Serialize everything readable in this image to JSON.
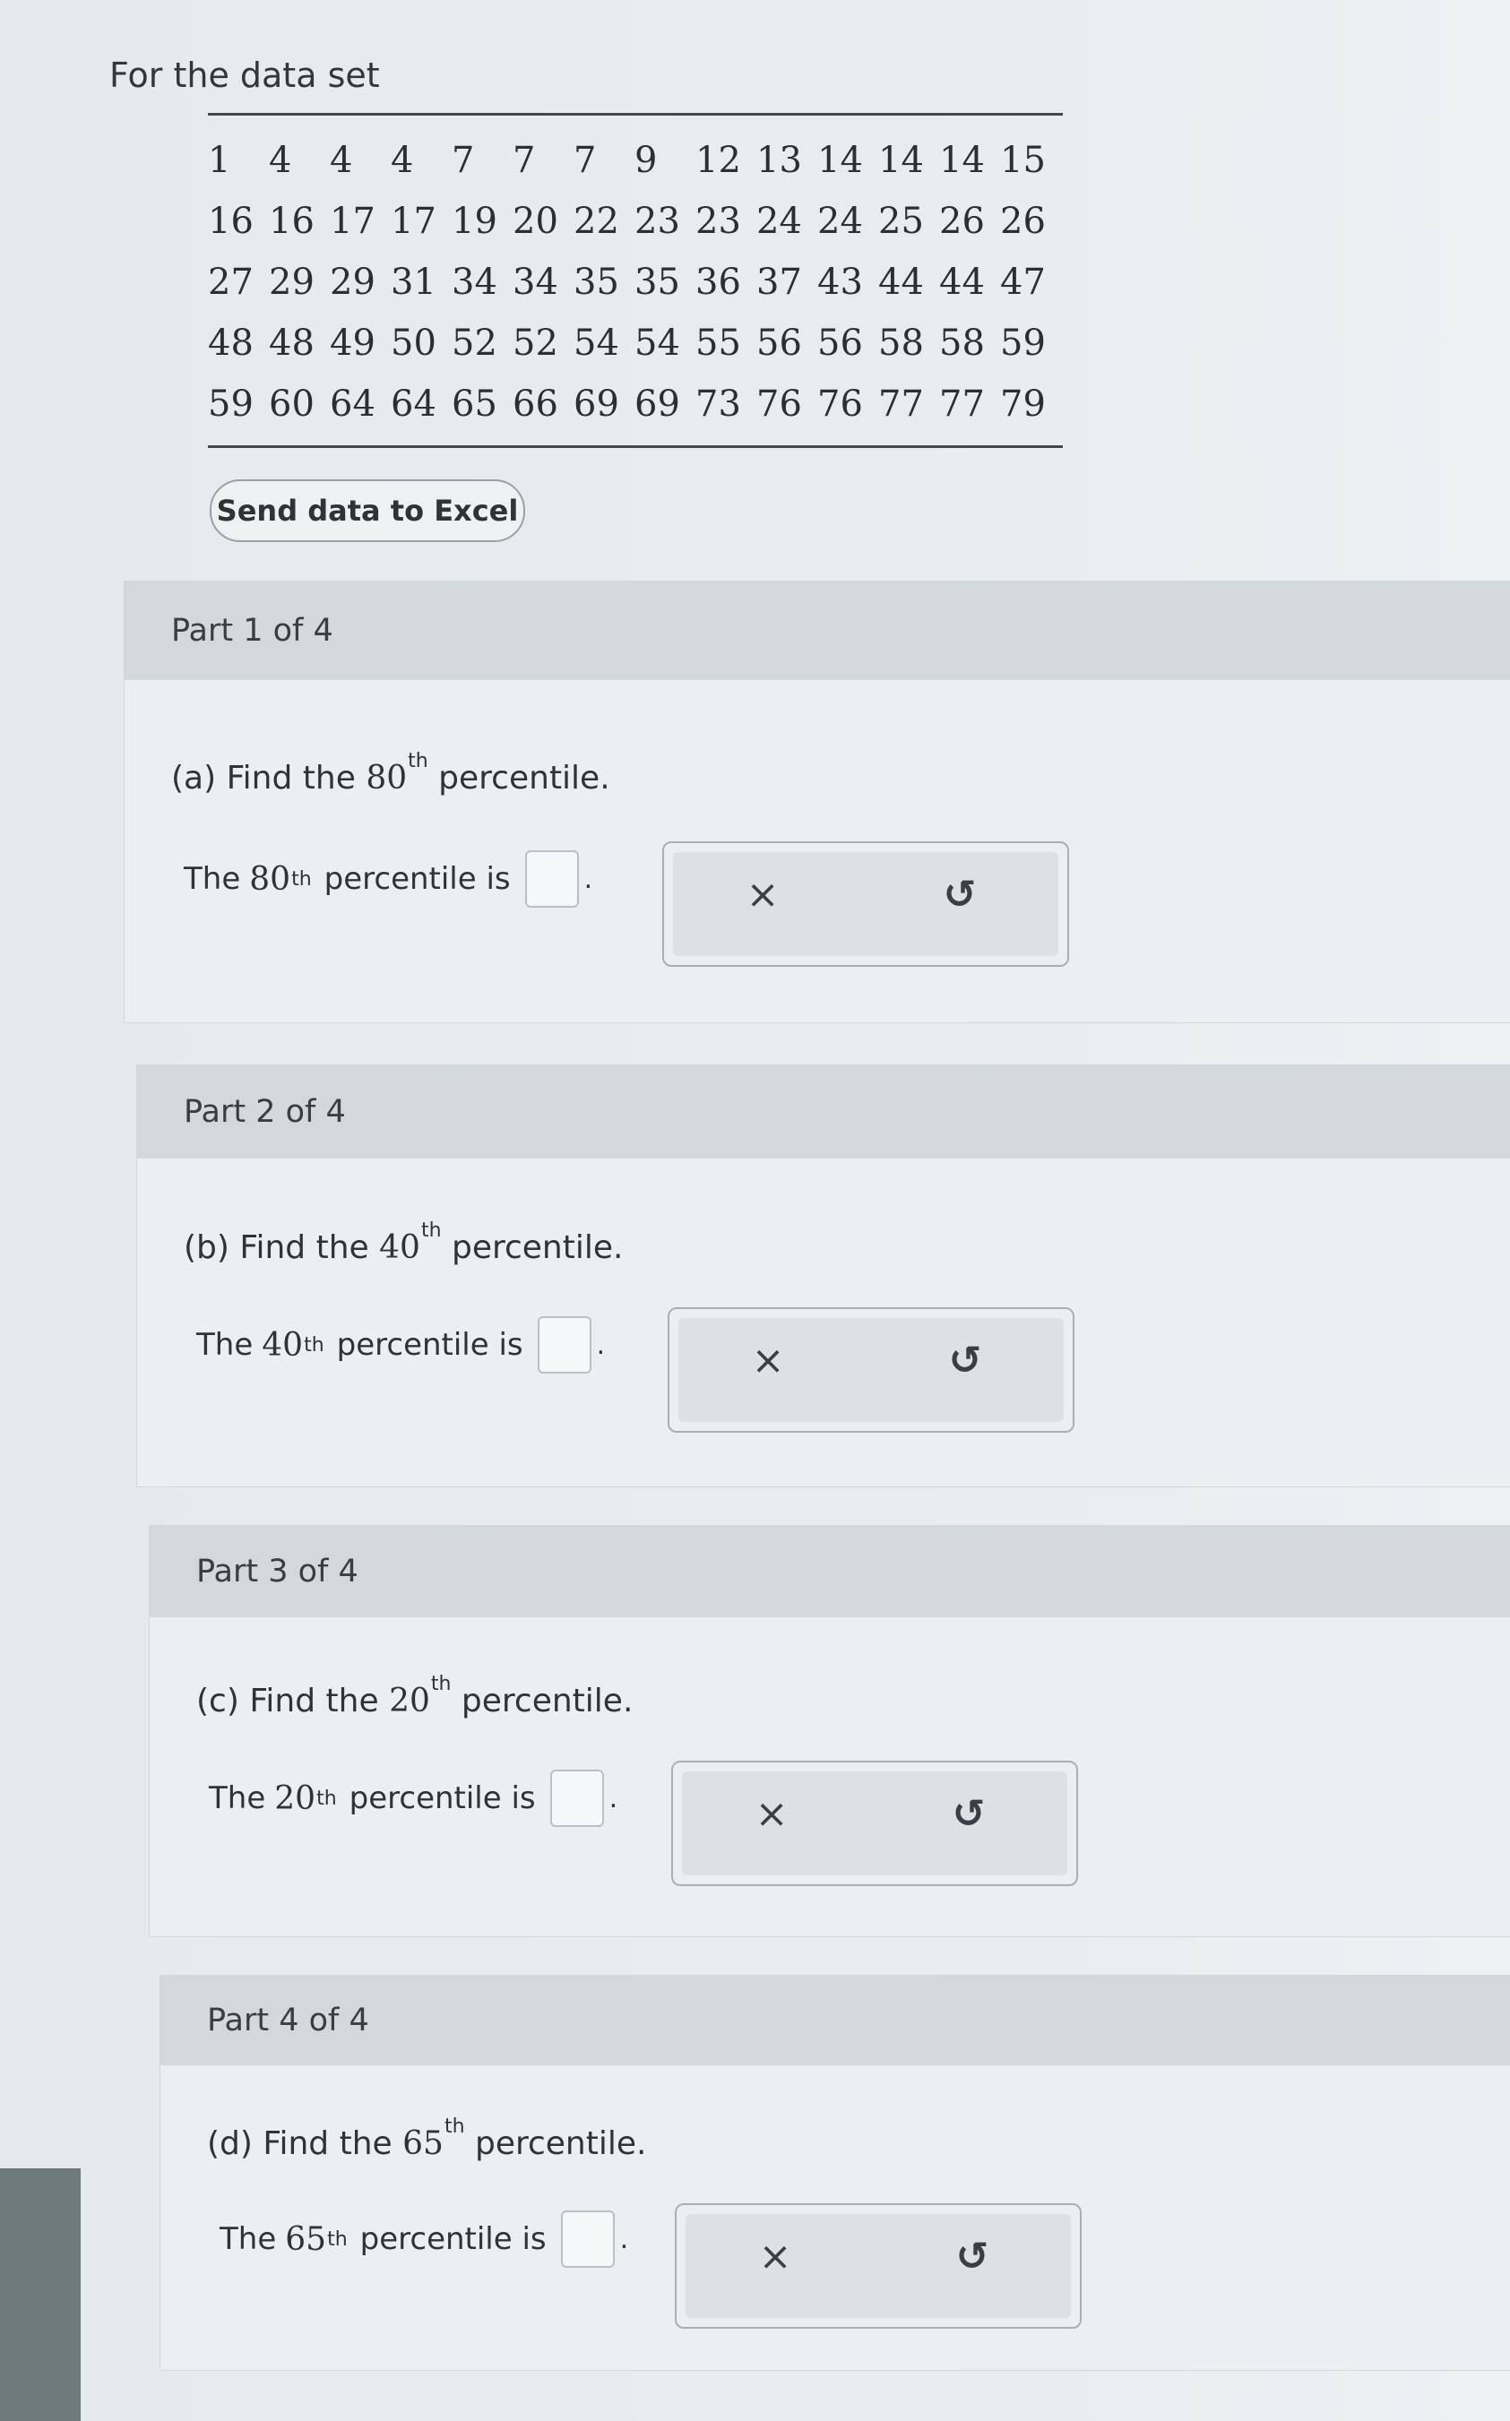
{
  "intro": "For the data set",
  "dataset": {
    "rows": [
      [
        "1",
        "4",
        "4",
        "4",
        "7",
        "7",
        "7",
        "9",
        "12",
        "13",
        "14",
        "14",
        "14",
        "15"
      ],
      [
        "16",
        "16",
        "17",
        "17",
        "19",
        "20",
        "22",
        "23",
        "23",
        "24",
        "24",
        "25",
        "26",
        "26"
      ],
      [
        "27",
        "29",
        "29",
        "31",
        "34",
        "34",
        "35",
        "35",
        "36",
        "37",
        "43",
        "44",
        "44",
        "47"
      ],
      [
        "48",
        "48",
        "49",
        "50",
        "52",
        "52",
        "54",
        "54",
        "55",
        "56",
        "56",
        "58",
        "58",
        "59"
      ],
      [
        "59",
        "60",
        "64",
        "64",
        "65",
        "66",
        "69",
        "69",
        "73",
        "76",
        "76",
        "77",
        "77",
        "79"
      ]
    ]
  },
  "excel_button": "Send data to Excel",
  "parts": [
    {
      "header": "Part 1 of 4",
      "q_prefix": "(a) Find the",
      "num": "80",
      "ord": "th",
      "q_suffix": "percentile.",
      "a_prefix": "The",
      "a_suffix": "percentile is",
      "period": "."
    },
    {
      "header": "Part 2 of 4",
      "q_prefix": "(b) Find the",
      "num": "40",
      "ord": "th",
      "q_suffix": "percentile.",
      "a_prefix": "The",
      "a_suffix": "percentile is",
      "period": "."
    },
    {
      "header": "Part 3 of 4",
      "q_prefix": "(c) Find the",
      "num": "20",
      "ord": "th",
      "q_suffix": "percentile.",
      "a_prefix": "The",
      "a_suffix": "percentile is",
      "period": "."
    },
    {
      "header": "Part 4 of 4",
      "q_prefix": "(d) Find the",
      "num": "65",
      "ord": "th",
      "q_suffix": "percentile.",
      "a_prefix": "The",
      "a_suffix": "percentile is",
      "period": "."
    }
  ],
  "tools": {
    "clear_icon": "close-icon",
    "clear_glyph": "×",
    "undo_icon": "undo-icon",
    "undo_glyph": "↺"
  }
}
